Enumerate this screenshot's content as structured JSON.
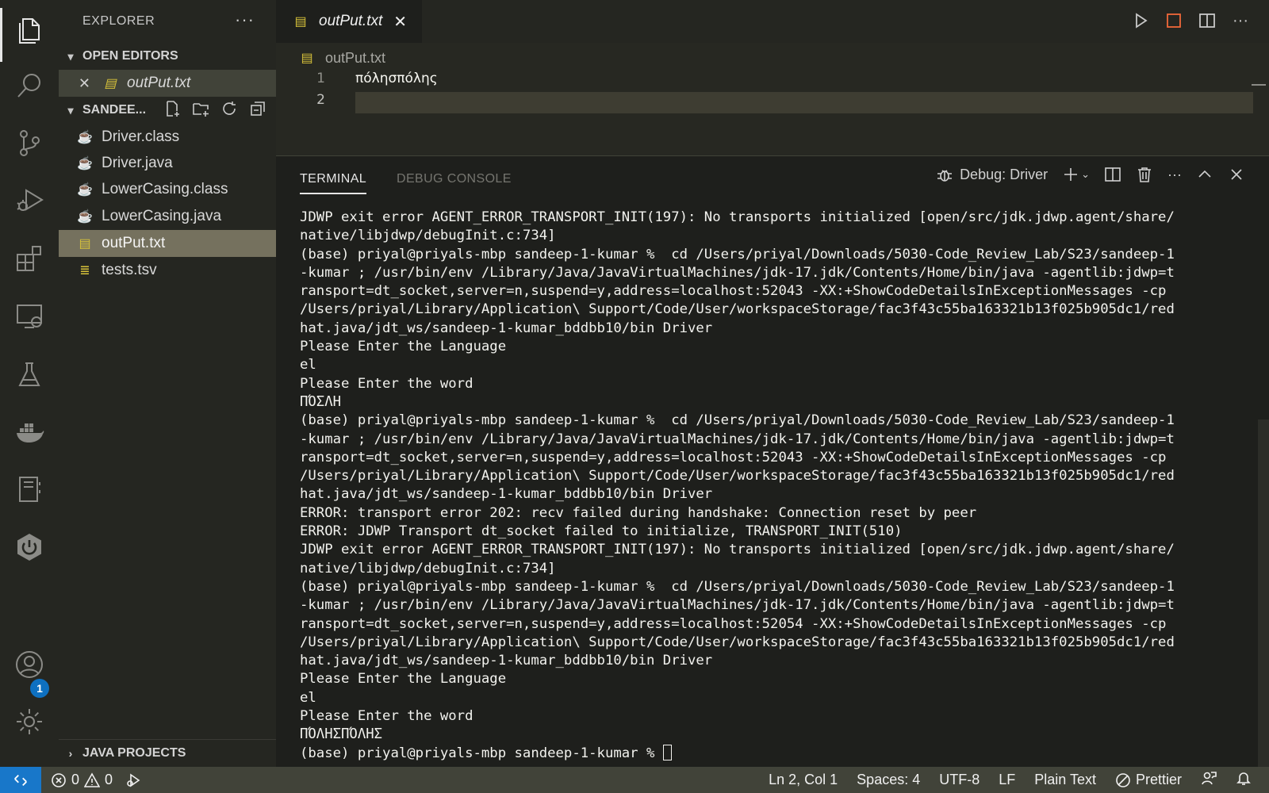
{
  "sidebar": {
    "title": "EXPLORER",
    "more": "···",
    "open_editors": {
      "label": "OPEN EDITORS",
      "items": [
        {
          "name": "outPut.txt"
        }
      ]
    },
    "folder": {
      "label": "SANDEE...",
      "files": [
        {
          "name": "Driver.class",
          "type": "java"
        },
        {
          "name": "Driver.java",
          "type": "java"
        },
        {
          "name": "LowerCasing.class",
          "type": "java"
        },
        {
          "name": "LowerCasing.java",
          "type": "java"
        },
        {
          "name": "outPut.txt",
          "type": "txt",
          "selected": true
        },
        {
          "name": "tests.tsv",
          "type": "tsv"
        }
      ]
    },
    "java_projects": "JAVA PROJECTS"
  },
  "activity_bar": {
    "icons": [
      "files-icon",
      "search-icon",
      "source-control-icon",
      "run-debug-icon",
      "extensions-icon",
      "remote-explorer-icon",
      "testing-icon",
      "docker-icon",
      "notebook-icon",
      "power-icon",
      "account-icon",
      "settings-gear-icon"
    ],
    "account_badge": "1"
  },
  "editor": {
    "tab": {
      "label": "outPut.txt",
      "close": "✕"
    },
    "breadcrumb": "outPut.txt",
    "lines": [
      {
        "num": "1",
        "text": "πόλησπόλης"
      },
      {
        "num": "2",
        "text": ""
      }
    ]
  },
  "panel": {
    "tabs": [
      {
        "label": "TERMINAL",
        "active": true
      },
      {
        "label": "DEBUG CONSOLE",
        "active": false
      }
    ],
    "debug_label": "Debug: Driver",
    "terminal_lines": [
      "JDWP exit error AGENT_ERROR_TRANSPORT_INIT(197): No transports initialized [open/src/jdk.jdwp.agent/share/",
      "native/libjdwp/debugInit.c:734]",
      "(base) priyal@priyals-mbp sandeep-1-kumar %  cd /Users/priyal/Downloads/5030-Code_Review_Lab/S23/sandeep-1",
      "-kumar ; /usr/bin/env /Library/Java/JavaVirtualMachines/jdk-17.jdk/Contents/Home/bin/java -agentlib:jdwp=t",
      "ransport=dt_socket,server=n,suspend=y,address=localhost:52043 -XX:+ShowCodeDetailsInExceptionMessages -cp",
      "/Users/priyal/Library/Application\\ Support/Code/User/workspaceStorage/fac3f43c55ba163321b13f025b905dc1/red",
      "hat.java/jdt_ws/sandeep-1-kumar_bddbb10/bin Driver",
      "Please Enter the Language",
      "el",
      "Please Enter the word",
      "ΠΌΣΛΗ",
      "(base) priyal@priyals-mbp sandeep-1-kumar %  cd /Users/priyal/Downloads/5030-Code_Review_Lab/S23/sandeep-1",
      "-kumar ; /usr/bin/env /Library/Java/JavaVirtualMachines/jdk-17.jdk/Contents/Home/bin/java -agentlib:jdwp=t",
      "ransport=dt_socket,server=n,suspend=y,address=localhost:52043 -XX:+ShowCodeDetailsInExceptionMessages -cp",
      "/Users/priyal/Library/Application\\ Support/Code/User/workspaceStorage/fac3f43c55ba163321b13f025b905dc1/red",
      "hat.java/jdt_ws/sandeep-1-kumar_bddbb10/bin Driver",
      "ERROR: transport error 202: recv failed during handshake: Connection reset by peer",
      "ERROR: JDWP Transport dt_socket failed to initialize, TRANSPORT_INIT(510)",
      "JDWP exit error AGENT_ERROR_TRANSPORT_INIT(197): No transports initialized [open/src/jdk.jdwp.agent/share/",
      "native/libjdwp/debugInit.c:734]",
      "(base) priyal@priyals-mbp sandeep-1-kumar %  cd /Users/priyal/Downloads/5030-Code_Review_Lab/S23/sandeep-1",
      "-kumar ; /usr/bin/env /Library/Java/JavaVirtualMachines/jdk-17.jdk/Contents/Home/bin/java -agentlib:jdwp=t",
      "ransport=dt_socket,server=n,suspend=y,address=localhost:52054 -XX:+ShowCodeDetailsInExceptionMessages -cp",
      "/Users/priyal/Library/Application\\ Support/Code/User/workspaceStorage/fac3f43c55ba163321b13f025b905dc1/red",
      "hat.java/jdt_ws/sandeep-1-kumar_bddbb10/bin Driver",
      "Please Enter the Language",
      "el",
      "Please Enter the word",
      "ΠΌΛΗΣΠΌΛΗΣ"
    ],
    "prompt": "(base) priyal@priyals-mbp sandeep-1-kumar % "
  },
  "statusbar": {
    "errors": "0",
    "warnings": "0",
    "position": "Ln 2, Col 1",
    "spaces": "Spaces: 4",
    "encoding": "UTF-8",
    "eol": "LF",
    "language": "Plain Text",
    "formatter": "Prettier"
  },
  "colors": {
    "accent": "#1877c9",
    "selection": "#75715e",
    "statusbar": "#414339",
    "editor_bg": "#272822"
  }
}
